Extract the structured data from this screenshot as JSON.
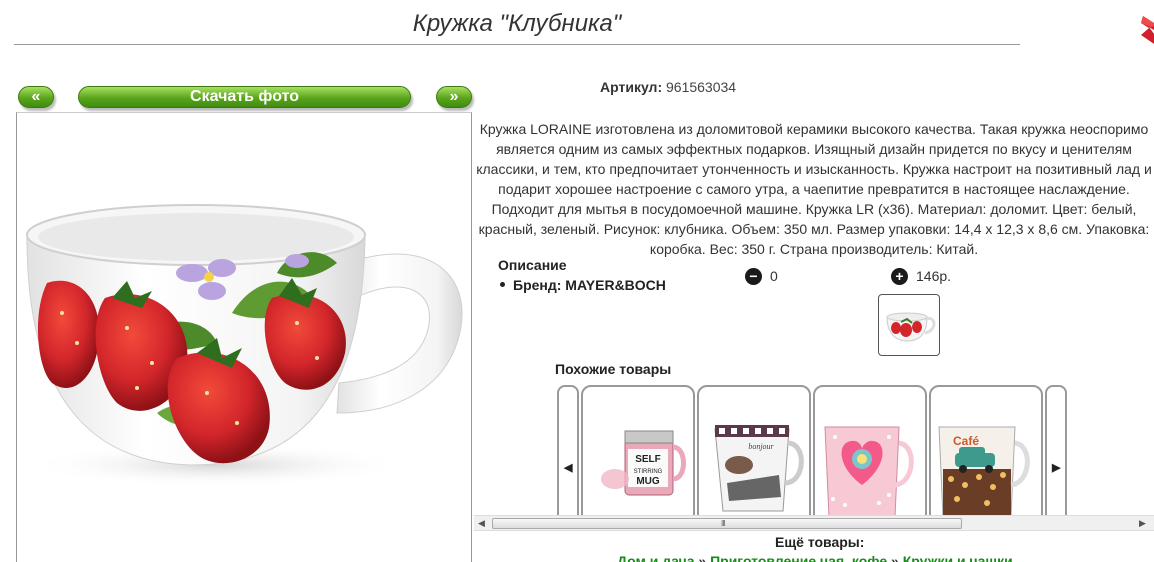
{
  "page": {
    "title": "Кружка \"Клубника\""
  },
  "nav": {
    "prev_label": "«",
    "download_label": "Скачать фото",
    "next_label": "»"
  },
  "product": {
    "article_label": "Артикул:",
    "article_value": "961563034",
    "description": "Кружка LORAINE изготовлена из доломитовой керамики высокого качества. Такая кружка неоспоримо является одним из самых эффектных подарков. Изящный дизайн придется по вкусу и ценителям классики, и тем, кто предпочитает утонченность и изысканность. Кружка настроит на позитивный лад и подарит хорошее настроение с самого утра, а чаепитие превратится в настоящее наслаждение. Подходит для мытья в посудомоечной машине. Кружка LR (x36). Материал: доломит. Цвет: белый, красный, зеленый. Рисунок: клубника. Объем: 350 мл. Размер упаковки: 14,4 х 12,3 х 8,6 см. Упаковка: коробка. Вес: 350 г. Страна производитель: Китай.",
    "section_title": "Описание",
    "brand_line": "Бренд: MAYER&BOCH",
    "minus_symbol": "−",
    "minus_value": "0",
    "plus_symbol": "+",
    "plus_value": "146р."
  },
  "similar": {
    "title": "Похожие товары",
    "prev_icon": "◀",
    "next_icon": "▶",
    "items": [
      {
        "name": "self-stirring-mug",
        "text": "SELF STIRRING MUG"
      },
      {
        "name": "bonjour-mug",
        "text": "bonjour"
      },
      {
        "name": "pink-heart-mug",
        "text": ""
      },
      {
        "name": "retro-car-mug",
        "text": "Café"
      }
    ]
  },
  "scroll": {
    "left_arrow": "◀",
    "right_arrow": "▶",
    "grip": "III"
  },
  "more": {
    "title": "Ещё товары:",
    "crumbs": [
      "Дом и дача",
      "Приготовление чая, кофе",
      "Кружки и чашки"
    ],
    "separator": "»"
  },
  "colors": {
    "green_button": "#5aa51c",
    "link_green": "#1a8a1a",
    "close_red": "#d0202a",
    "strawberry_red": "#d2262b"
  },
  "icons": {
    "close": "close-icon",
    "minus": "minus-circle-icon",
    "plus": "plus-circle-icon"
  }
}
